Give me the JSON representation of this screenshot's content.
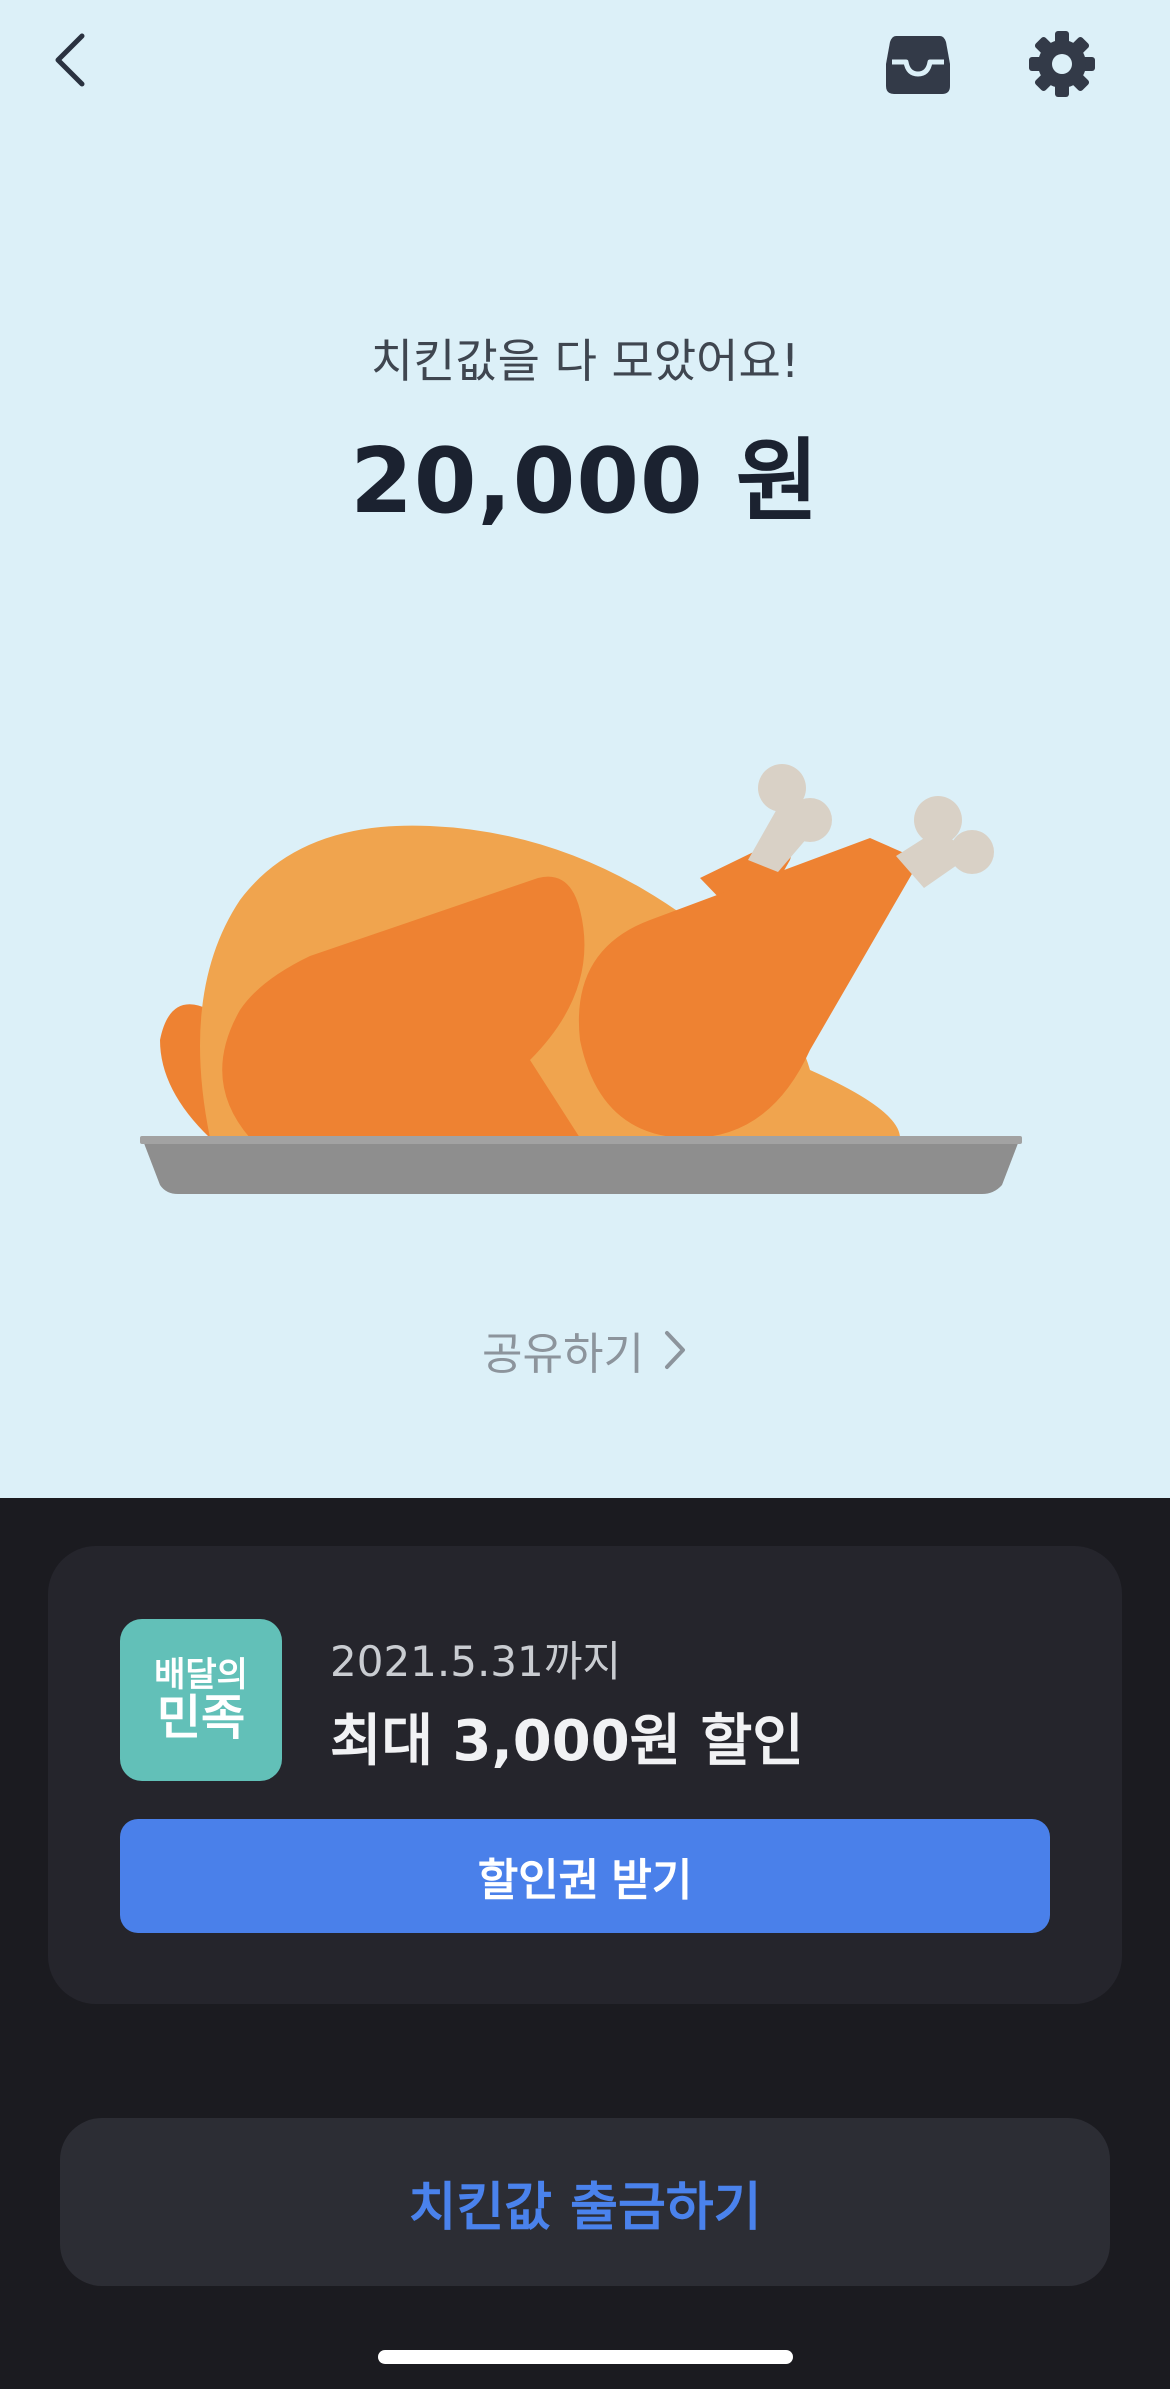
{
  "header": {
    "back_icon": "chevron-left-icon",
    "inbox_icon": "inbox-icon",
    "settings_icon": "gear-icon"
  },
  "hero": {
    "subtitle": "치킨값을 다 모았어요!",
    "amount": "20,000 원",
    "illustration": "roast-chicken-on-tray",
    "share_label": "공유하기"
  },
  "coupon": {
    "logo_line1": "배달의",
    "logo_line2": "민족",
    "expiry": "2021.5.31까지",
    "title": "최대 3,000원 할인",
    "button_label": "할인권 받기"
  },
  "withdraw_label": "치킨값 출금하기",
  "colors": {
    "top_bg": "#dcf0f8",
    "bottom_bg": "#1b1b20",
    "card_bg": "#25252c",
    "accent": "#4a80ea",
    "logo_bg": "#62c0b8"
  }
}
